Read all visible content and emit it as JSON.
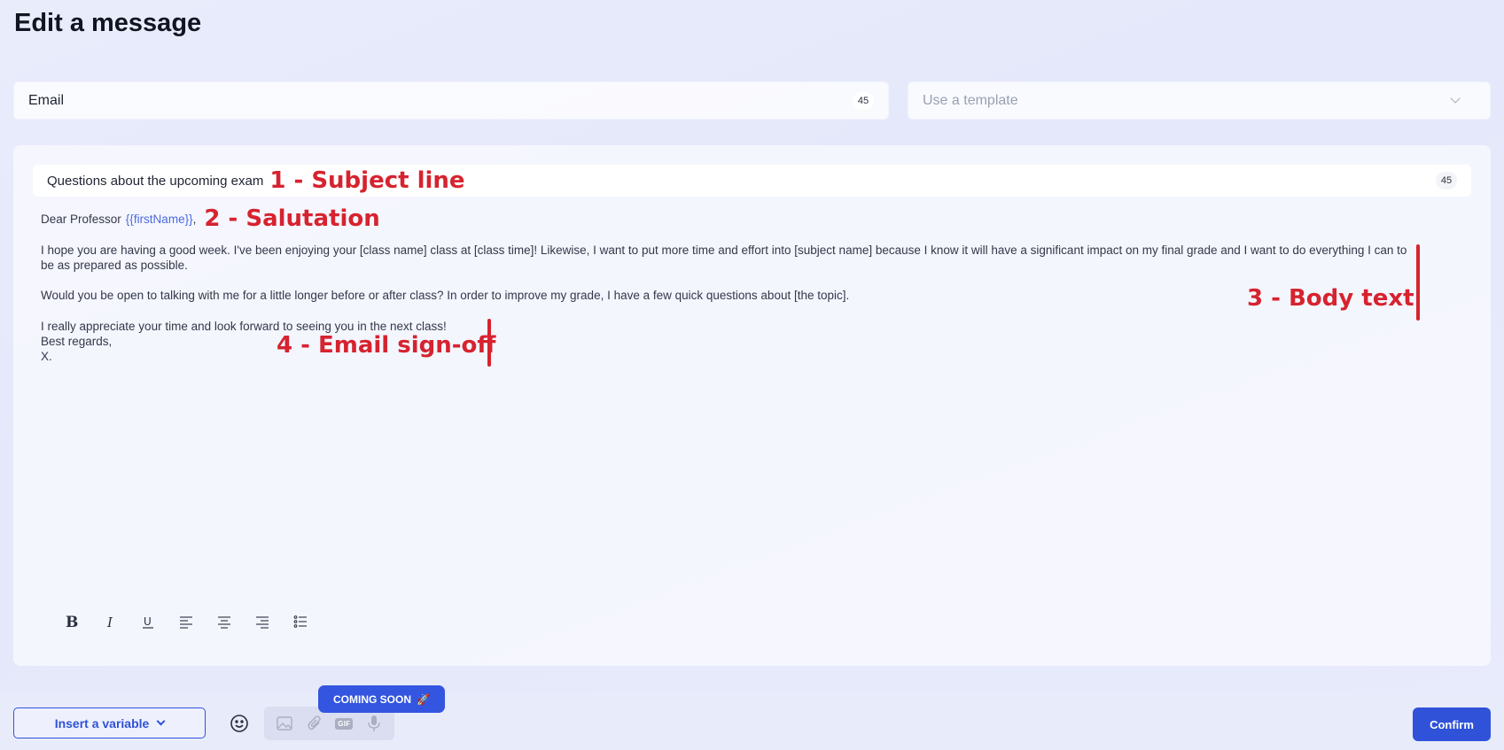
{
  "page": {
    "title": "Edit a message"
  },
  "channel": {
    "value": "Email",
    "count": "45"
  },
  "template": {
    "placeholder": "Use a template"
  },
  "subject": {
    "text": "Questions about the upcoming exam",
    "count": "45"
  },
  "salutation": {
    "prefix": "Dear Professor",
    "variable": "{{firstName}}",
    "suffix": ","
  },
  "body": {
    "paragraphs": [
      "I hope you are having a good week. I've been enjoying your [class name] class at [class time]! Likewise, I want to put more time and effort into [subject name] because I know it will have a significant impact on my final grade and I want to do everything I can to be as prepared as possible.",
      "Would you be open to talking with me for a little longer before or after class? In order to improve my grade, I have a few quick questions about [the topic]."
    ]
  },
  "signoff": {
    "lines": [
      "I really appreciate your time and look forward to seeing you in the next class!",
      "Best regards,",
      "X."
    ]
  },
  "annotations": {
    "subject": "1 - Subject line",
    "salutation": "2 - Salutation",
    "body": "3 - Body text",
    "signoff": "4 - Email sign-off",
    "color": "#d6232f"
  },
  "toolbar": {
    "items": [
      "bold-icon",
      "italic-icon",
      "underline-icon",
      "align-left-icon",
      "align-center-icon",
      "align-right-icon",
      "bullet-list-icon"
    ]
  },
  "footer": {
    "insert_variable_label": "Insert a variable",
    "coming_soon_label": "COMING SOON",
    "coming_soon_icon": "🚀",
    "confirm_label": "Confirm",
    "media_icons": [
      "image-icon",
      "attachment-icon",
      "gif-icon",
      "microphone-icon"
    ]
  },
  "colors": {
    "accent": "#2f52d8",
    "variable": "#4a6be0"
  }
}
